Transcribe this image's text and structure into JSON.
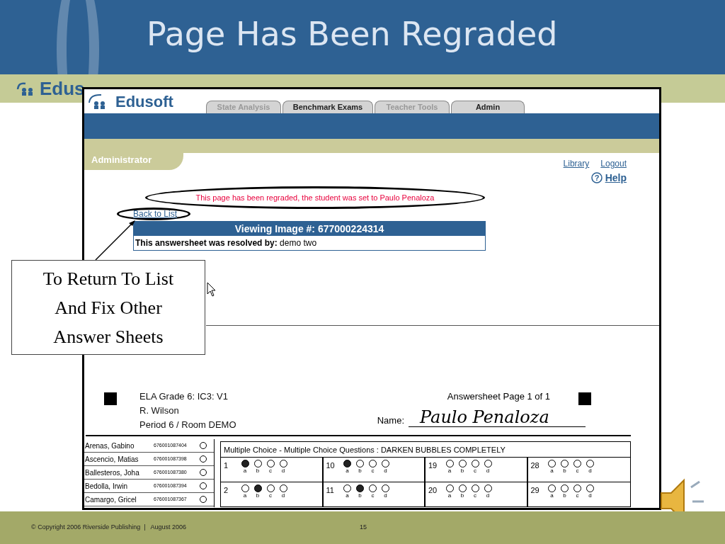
{
  "slide": {
    "title": "Page Has Been Regraded",
    "logo_text": "Edus"
  },
  "screenshot": {
    "logo_text": "Edusoft",
    "tabs": [
      {
        "label": "State Analysis",
        "disabled": true
      },
      {
        "label": "Benchmark Exams",
        "disabled": false
      },
      {
        "label": "Teacher Tools",
        "disabled": true
      },
      {
        "label": "Admin",
        "disabled": false
      }
    ],
    "role": "Administrator",
    "links": [
      "Library",
      "Logout"
    ],
    "help_icon": "?",
    "help": "Help",
    "message": "This page has been regraded, the student was set to Paulo Penaloza",
    "back_link": "Back to List",
    "panel": {
      "title": "Viewing Image #: 677000224314",
      "resolved_label": "This answersheet was resolved by:",
      "resolved_by": "demo two"
    },
    "sheet": {
      "test": "ELA Grade 6: IC3: V1",
      "teacher": "R. Wilson",
      "period": "Period 6 / Room DEMO",
      "page": "Answersheet Page 1 of 1",
      "name_label": "Name:",
      "name_value": "Paulo Penaloza",
      "students": [
        {
          "name": "Arenas, Gabino",
          "id": "676001087404"
        },
        {
          "name": "Ascencio, Matias",
          "id": "676001087398"
        },
        {
          "name": "Ballesteros, Joha",
          "id": "676001087380"
        },
        {
          "name": "Bedolla, Irwin",
          "id": "676001087394"
        },
        {
          "name": "Camargo, Gricel",
          "id": "676001087367"
        }
      ],
      "instructions": "Multiple Choice - Multiple Choice Questions : DARKEN BUBBLES COMPLETELY",
      "question_rows": [
        [
          {
            "number": "1",
            "choices": [
              {
                "letter": "a",
                "filled": true
              },
              {
                "letter": "b",
                "filled": false
              },
              {
                "letter": "c",
                "filled": false
              },
              {
                "letter": "d",
                "filled": false
              }
            ]
          },
          {
            "number": "10",
            "choices": [
              {
                "letter": "a",
                "filled": true
              },
              {
                "letter": "b",
                "filled": false
              },
              {
                "letter": "c",
                "filled": false
              },
              {
                "letter": "d",
                "filled": false
              }
            ]
          },
          {
            "number": "19",
            "choices": [
              {
                "letter": "a",
                "filled": false
              },
              {
                "letter": "b",
                "filled": false
              },
              {
                "letter": "c",
                "filled": false
              },
              {
                "letter": "d",
                "filled": false
              }
            ]
          },
          {
            "number": "28",
            "choices": [
              {
                "letter": "a",
                "filled": false
              },
              {
                "letter": "b",
                "filled": false
              },
              {
                "letter": "c",
                "filled": false
              },
              {
                "letter": "d",
                "filled": false
              }
            ]
          }
        ],
        [
          {
            "number": "2",
            "choices": [
              {
                "letter": "a",
                "filled": false
              },
              {
                "letter": "b",
                "filled": true
              },
              {
                "letter": "c",
                "filled": false
              },
              {
                "letter": "d",
                "filled": false
              }
            ]
          },
          {
            "number": "11",
            "choices": [
              {
                "letter": "a",
                "filled": false
              },
              {
                "letter": "b",
                "filled": true
              },
              {
                "letter": "c",
                "filled": false
              },
              {
                "letter": "d",
                "filled": false
              }
            ]
          },
          {
            "number": "20",
            "choices": [
              {
                "letter": "a",
                "filled": false
              },
              {
                "letter": "b",
                "filled": false
              },
              {
                "letter": "c",
                "filled": false
              },
              {
                "letter": "d",
                "filled": false
              }
            ]
          },
          {
            "number": "29",
            "choices": [
              {
                "letter": "a",
                "filled": false
              },
              {
                "letter": "b",
                "filled": false
              },
              {
                "letter": "c",
                "filled": false
              },
              {
                "letter": "d",
                "filled": false
              }
            ]
          }
        ]
      ]
    }
  },
  "callout": {
    "lines": [
      "To Return To List",
      "And Fix Other",
      "Answer Sheets"
    ]
  },
  "footer": {
    "copyright": "© Copyright 2006 Riverside Publishing  |   August 2006",
    "page_number": "15"
  }
}
